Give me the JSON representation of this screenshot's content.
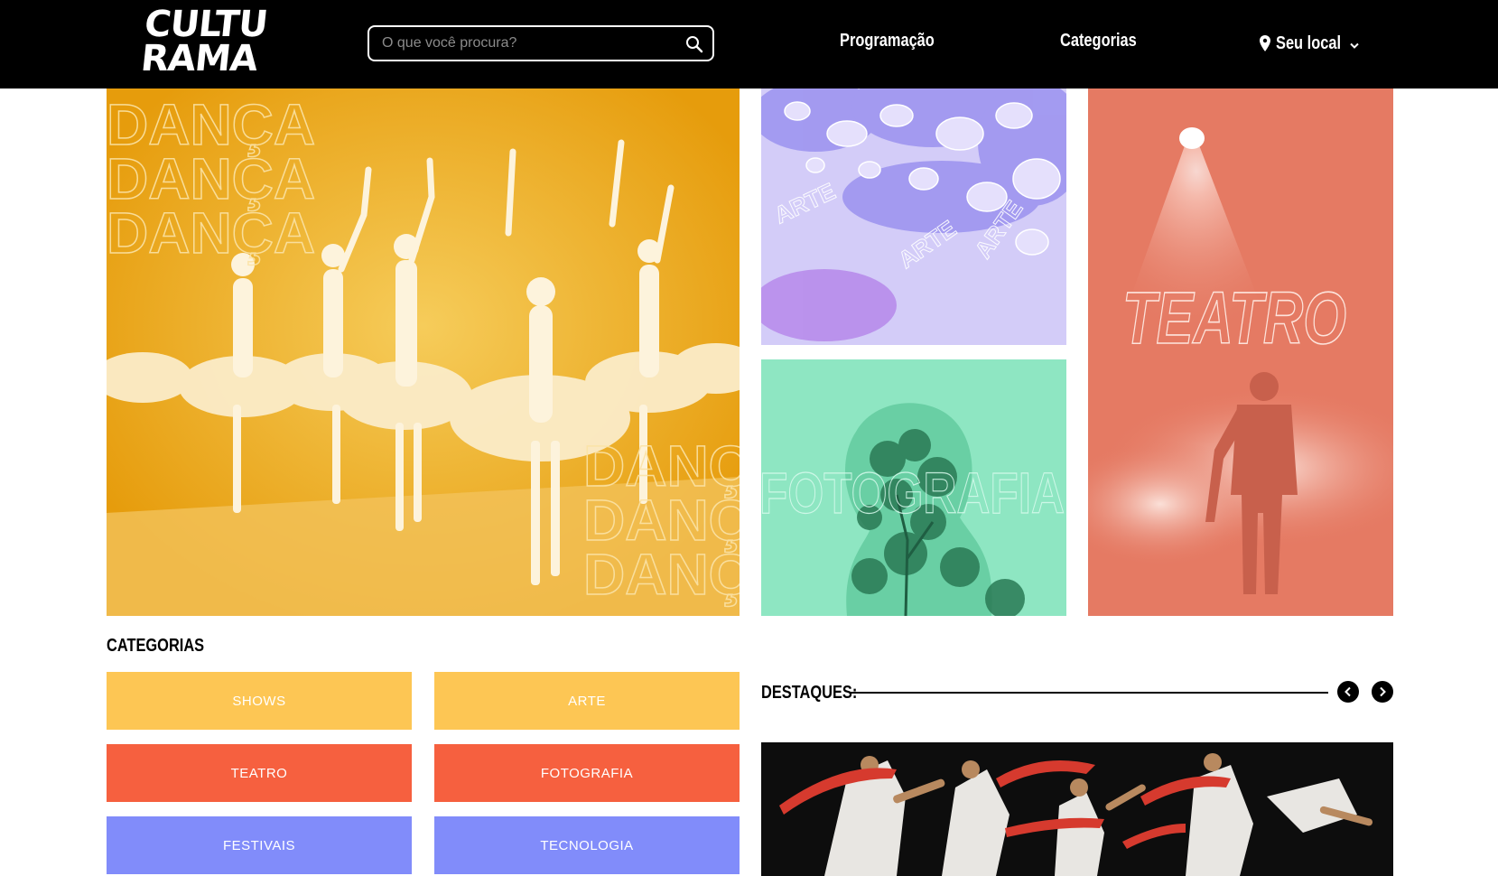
{
  "header": {
    "logo_line1": "CULTU",
    "logo_line2": "RAMA",
    "search_placeholder": "O que você procura?",
    "nav": {
      "programacao": "Programação",
      "categorias": "Categorias",
      "local": "Seu local"
    }
  },
  "hero": {
    "tiles": [
      {
        "name": "danca",
        "word": "DANÇA",
        "color": "#eda915"
      },
      {
        "name": "arte",
        "word": "ARTE",
        "color": "#c9c1f6"
      },
      {
        "name": "fotografia",
        "word": "FOTOGRAFIA",
        "color": "#8ee6c2"
      },
      {
        "name": "teatro",
        "word": "TEATRO",
        "color": "#e57a63"
      }
    ]
  },
  "categorias": {
    "title": "CATEGORIAS",
    "items": [
      {
        "label": "SHOWS",
        "color": "#fdc654"
      },
      {
        "label": "ARTE",
        "color": "#fdc654"
      },
      {
        "label": "TEATRO",
        "color": "#f6603f"
      },
      {
        "label": "FOTOGRAFIA",
        "color": "#f6603f"
      },
      {
        "label": "FESTIVAIS",
        "color": "#818cfa"
      },
      {
        "label": "TECNOLOGIA",
        "color": "#818cfa"
      }
    ]
  },
  "destaques": {
    "title": "DESTAQUES:"
  },
  "icons": {
    "search": "search-icon",
    "location": "location-pin-icon",
    "dropdown": "chevron-down-icon",
    "prev": "chevron-left-icon",
    "next": "chevron-right-icon"
  }
}
